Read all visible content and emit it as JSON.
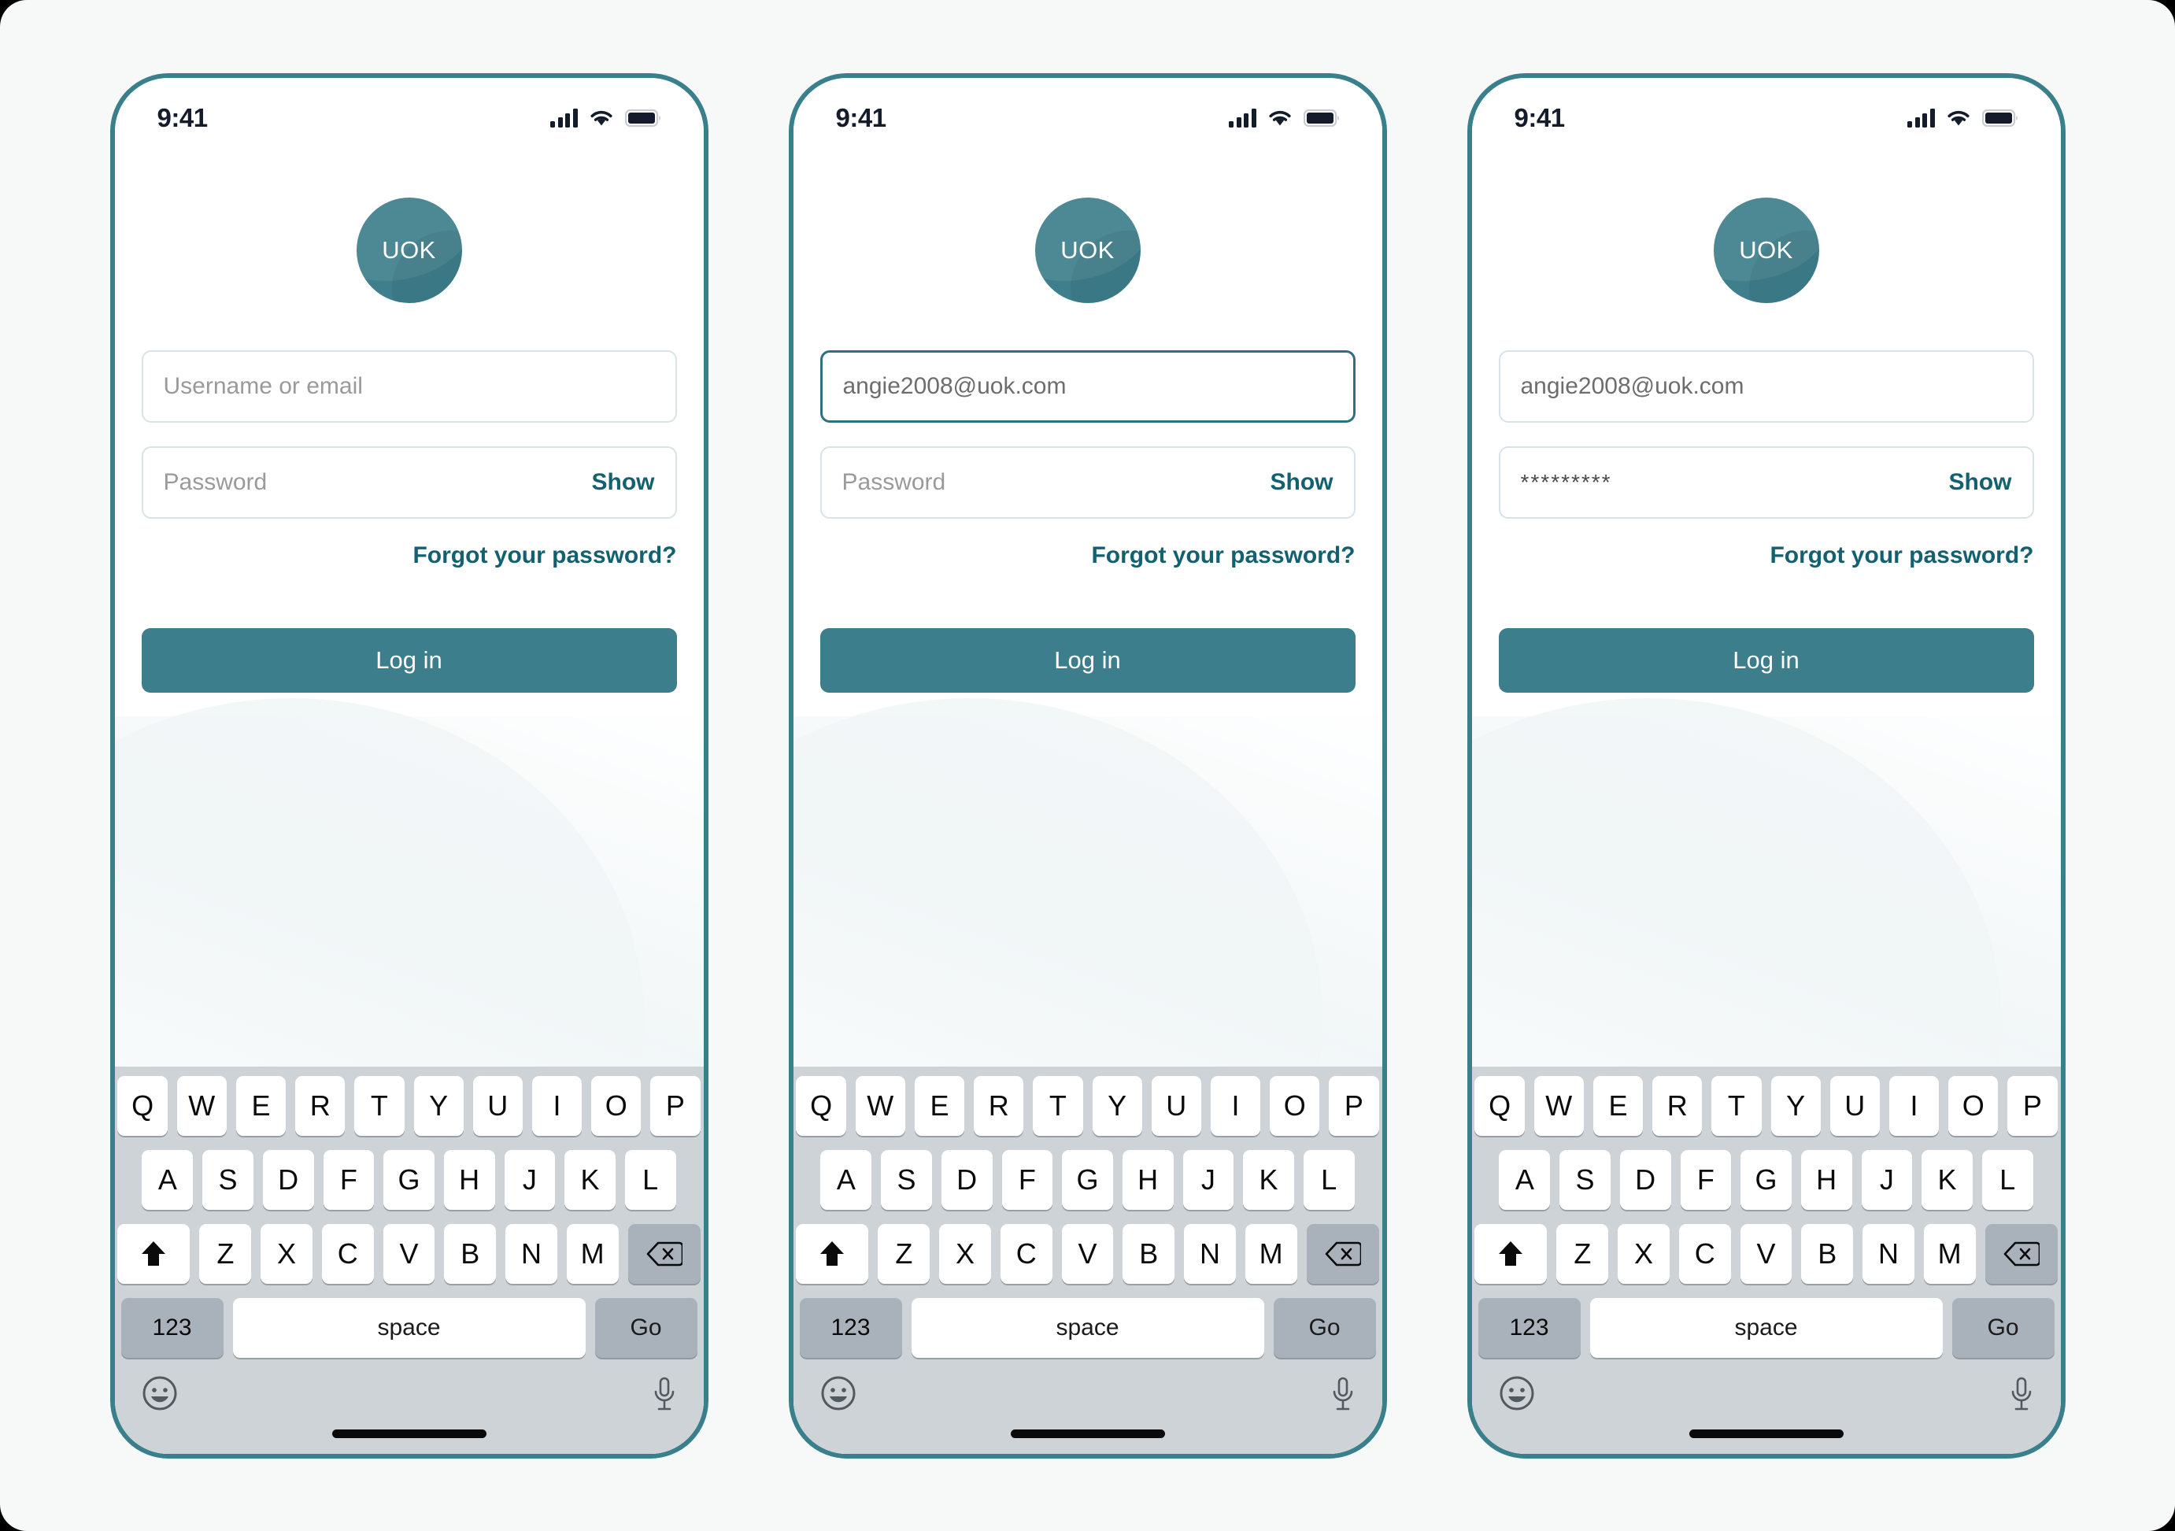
{
  "canvas": {
    "background": "#f7f8f8",
    "outer_background": "#000000"
  },
  "theme": {
    "teal_frame": "#3a7f8c",
    "teal_brand": "#3f7f8d",
    "teal_link": "#13616f",
    "teal_button": "#3d7e8c",
    "field_border": "#d7e3e6",
    "field_border_focused": "#2d7180",
    "keyboard_bg": "#ced3d7",
    "key_bg": "#ffffff",
    "key_gray_bg": "#a9b2ba",
    "placeholder_text": "#9a9a9a",
    "status_text": "#141b2b"
  },
  "status_bar": {
    "time": "9:41",
    "signal_icon": "cellular-signal-icon",
    "wifi_icon": "wifi-icon",
    "battery_icon": "battery-full-icon"
  },
  "logo": {
    "text": "UOK",
    "name": "uok-logo"
  },
  "keyboard": {
    "row1": [
      "Q",
      "W",
      "E",
      "R",
      "T",
      "Y",
      "U",
      "I",
      "O",
      "P"
    ],
    "row2": [
      "A",
      "S",
      "D",
      "F",
      "G",
      "H",
      "J",
      "K",
      "L"
    ],
    "row3": [
      "Z",
      "X",
      "C",
      "V",
      "B",
      "N",
      "M"
    ],
    "shift_label": "shift",
    "backspace_label": "backspace",
    "numbers_label": "123",
    "space_label": "space",
    "go_label": "Go",
    "emoji_label": "emoji",
    "mic_label": "dictation"
  },
  "screens": [
    {
      "id": "screen-empty",
      "username": {
        "value": "",
        "placeholder": "Username or email",
        "focused": false
      },
      "password": {
        "value": "",
        "placeholder": "Password",
        "focused": false,
        "show_label": "Show"
      },
      "forgot_label": "Forgot your password?",
      "login_label": "Log in"
    },
    {
      "id": "screen-email-entered",
      "username": {
        "value": "angie2008@uok.com",
        "placeholder": "Username or email",
        "focused": true
      },
      "password": {
        "value": "",
        "placeholder": "Password",
        "focused": false,
        "show_label": "Show"
      },
      "forgot_label": "Forgot your password?",
      "login_label": "Log in"
    },
    {
      "id": "screen-password-entered",
      "username": {
        "value": "angie2008@uok.com",
        "placeholder": "Username or email",
        "focused": false
      },
      "password": {
        "value": "*********",
        "placeholder": "Password",
        "focused": false,
        "show_label": "Show"
      },
      "forgot_label": "Forgot your password?",
      "login_label": "Log in"
    }
  ]
}
